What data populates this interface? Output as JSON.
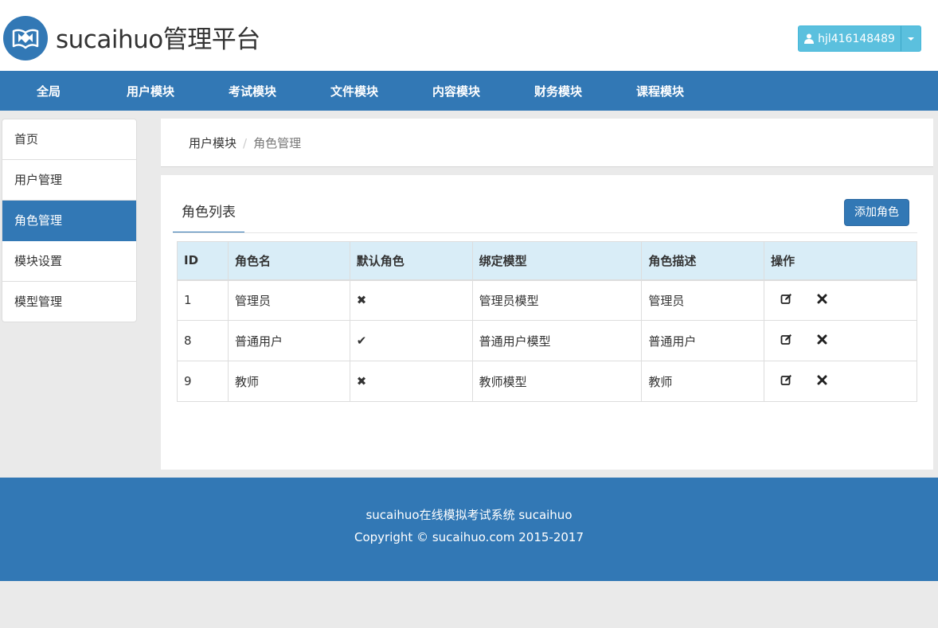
{
  "header": {
    "logo_icon": "book-logo-icon",
    "title": "sucaihuo管理平台",
    "user_name": "hjl416148489",
    "user_icon": "user-icon",
    "accent": "#5bc0de"
  },
  "nav": {
    "items": [
      "全局",
      "用户模块",
      "考试模块",
      "文件模块",
      "内容模块",
      "财务模块",
      "课程模块"
    ],
    "color": "#3278b5"
  },
  "sidebar": {
    "items": [
      "首页",
      "用户管理",
      "角色管理",
      "模块设置",
      "模型管理"
    ],
    "active": "角色管理"
  },
  "breadcrumb": {
    "parent": "用户模块",
    "separator": "/",
    "current": "角色管理"
  },
  "main": {
    "tab_label": "角色列表",
    "add_button": "添加角色",
    "table": {
      "headers": [
        "ID",
        "角色名",
        "默认角色",
        "绑定模型",
        "角色描述",
        "操作"
      ],
      "rows": [
        {
          "id": "1",
          "name": "管理员",
          "default": "✖",
          "model": "管理员模型",
          "desc": "管理员"
        },
        {
          "id": "8",
          "name": "普通用户",
          "default": "✔",
          "model": "普通用户模型",
          "desc": "普通用户"
        },
        {
          "id": "9",
          "name": "教师",
          "default": "✖",
          "model": "教师模型",
          "desc": "教师"
        }
      ],
      "row_actions": [
        "edit-icon",
        "delete-icon"
      ]
    }
  },
  "footer": {
    "line1": "sucaihuo在线模拟考试系统 sucaihuo",
    "line2": "Copyright © sucaihuo.com 2015-2017"
  }
}
